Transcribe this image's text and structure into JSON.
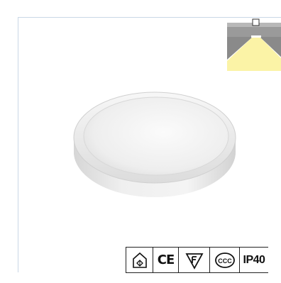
{
  "certifications": {
    "house_icon": "indoor-use-icon",
    "ce_label": "CE",
    "f_icon": "f-mark-icon",
    "ccc_label": "CCC",
    "ip_label": "IP40"
  },
  "colors": {
    "frame_border": "#c9d7e6",
    "light_beam": "#fbf3a6",
    "ceiling_grey": "#8a8a8a",
    "panel_white": "#ececec"
  }
}
